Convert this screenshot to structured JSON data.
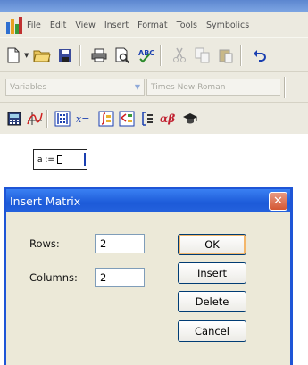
{
  "menubar": {
    "items": [
      "File",
      "Edit",
      "View",
      "Insert",
      "Format",
      "Tools",
      "Symbolics"
    ]
  },
  "toolbar_icons": [
    "new-document-icon",
    "open-folder-icon",
    "save-icon",
    "print-icon",
    "print-preview-icon",
    "spell-check-icon",
    "cut-icon",
    "copy-icon",
    "paste-icon",
    "undo-icon"
  ],
  "format_toolbar": {
    "style_value": "Variables",
    "font_value": "Times New Roman"
  },
  "math_toolbar_icons": [
    "calculator-toolbar-icon",
    "graph-toolbar-icon",
    "matrix-toolbar-icon",
    "evaluation-toolbar-icon",
    "calculus-toolbar-icon",
    "boolean-toolbar-icon",
    "programming-toolbar-icon",
    "greek-toolbar-icon",
    "symbolic-toolbar-icon"
  ],
  "math_labels": {
    "evaluation": "x=",
    "greek": "αβ"
  },
  "worksheet": {
    "expression": "a :="
  },
  "dialog": {
    "title": "Insert Matrix",
    "close_glyph": "✕",
    "rows_label": "Rows:",
    "rows_value": "2",
    "columns_label": "Columns:",
    "columns_value": "2",
    "buttons": {
      "ok": "OK",
      "insert": "Insert",
      "delete": "Delete",
      "cancel": "Cancel"
    }
  }
}
